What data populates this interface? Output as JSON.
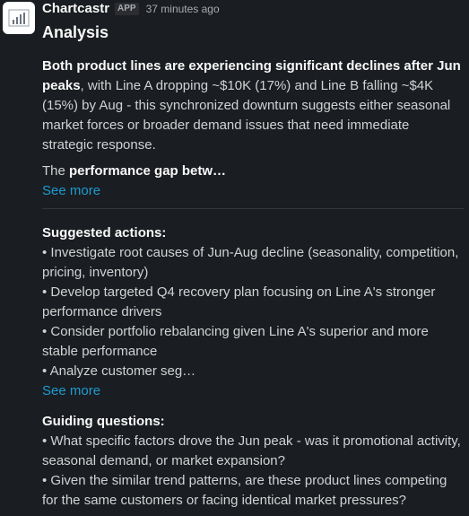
{
  "message": {
    "sender": "Chartcastr",
    "badge": "APP",
    "timestamp": "37 minutes ago",
    "title": "Analysis"
  },
  "analysis": {
    "intro_bold": "Both product lines are experiencing significant declines after Jun peaks",
    "intro_rest": ", with Line A dropping ~$10K (17%) and Line B falling ~$4K (15%) by Aug - this synchronized downturn suggests either seasonal market forces or broader demand issues that need immediate strategic response.",
    "gap_prefix": "The ",
    "gap_bold": "performance gap betw…",
    "see_more": "See more"
  },
  "suggested_actions": {
    "title": "Suggested actions:",
    "items": [
      "• Investigate root causes of Jun-Aug decline (seasonality, competition, pricing, inventory)",
      "• Develop targeted Q4 recovery plan focusing on Line A's stronger performance drivers",
      "• Consider portfolio rebalancing given Line A's superior and more stable performance",
      "• Analyze customer seg…"
    ],
    "see_more": "See more"
  },
  "guiding_questions": {
    "title": "Guiding questions:",
    "items": [
      "• What specific factors drove the Jun peak - was it promotional activity, seasonal demand, or market expansion?",
      "• Given the similar trend patterns, are these product lines competing for the same customers or facing identical market pressures?"
    ]
  }
}
